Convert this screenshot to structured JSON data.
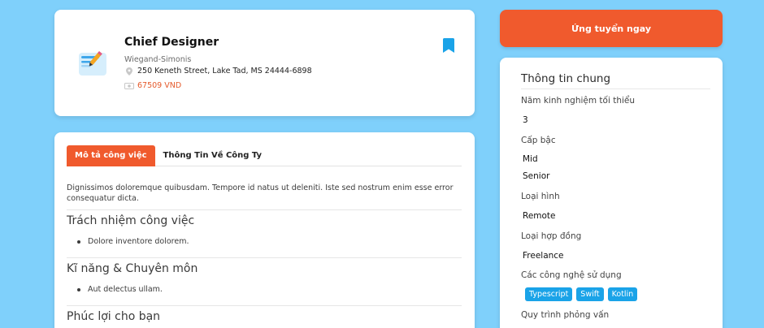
{
  "job": {
    "title": "Chief Designer",
    "company": "Wiegand-Simonis",
    "address": "250 Keneth Street, Lake Tad, MS 24444-6898",
    "salary": "67509 VND"
  },
  "tabs": [
    {
      "label": "Mô tả công việc",
      "active": true
    },
    {
      "label": "Thông Tin Về Công Ty",
      "active": false
    }
  ],
  "description": {
    "text": "Dignissimos doloremque quibusdam. Tempore id natus ut deleniti. Iste sed nostrum enim esse error consequatur dicta.",
    "sections": [
      {
        "heading": "Trách nhiệm công việc",
        "items": [
          "Dolore inventore dolorem."
        ]
      },
      {
        "heading": "Kĩ năng & Chuyên môn",
        "items": [
          "Aut delectus ullam."
        ]
      },
      {
        "heading": "Phúc lợi cho bạn",
        "items": []
      }
    ]
  },
  "apply": {
    "label": "Ứng tuyển ngay"
  },
  "info": {
    "title": "Thông tin chung",
    "experience_label": "Năm kinh nghiệm tối thiểu",
    "experience_value": "3",
    "level_label": "Cấp bậc",
    "levels": [
      "Mid",
      "Senior"
    ],
    "type_label": "Loại hình",
    "type_value": "Remote",
    "contract_label": "Loại hợp đồng",
    "contract_value": "Freelance",
    "tech_label": "Các công nghệ sử dụng",
    "technologies": [
      "Typescript",
      "Swift",
      "Kotlin"
    ],
    "process_label": "Quy trình phỏng vấn"
  },
  "colors": {
    "accent": "#f05a2d",
    "background": "#7fd0fb",
    "badge": "#1aa3e8",
    "bookmark": "#1aa3e8"
  }
}
